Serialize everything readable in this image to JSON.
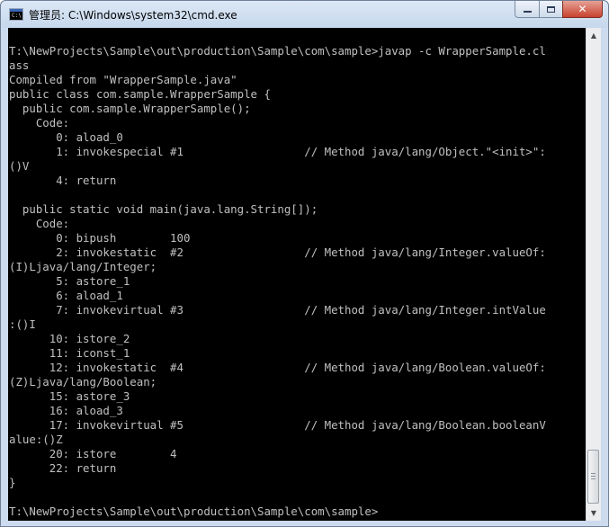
{
  "window": {
    "title": "管理员: C:\\Windows\\system32\\cmd.exe",
    "app_icon_text": "C:\\"
  },
  "caption_buttons": {
    "minimize_icon": "minimize-icon",
    "maximize_icon": "maximize-icon",
    "close_glyph": "✕"
  },
  "console": {
    "lines": [
      "T:\\NewProjects\\Sample\\out\\production\\Sample\\com\\sample>javap -c WrapperSample.cl",
      "ass",
      "Compiled from \"WrapperSample.java\"",
      "public class com.sample.WrapperSample {",
      "  public com.sample.WrapperSample();",
      "    Code:",
      "       0: aload_0",
      "       1: invokespecial #1                  // Method java/lang/Object.\"<init>\":",
      "()V",
      "       4: return",
      "",
      "  public static void main(java.lang.String[]);",
      "    Code:",
      "       0: bipush        100",
      "       2: invokestatic  #2                  // Method java/lang/Integer.valueOf:",
      "(I)Ljava/lang/Integer;",
      "       5: astore_1",
      "       6: aload_1",
      "       7: invokevirtual #3                  // Method java/lang/Integer.intValue",
      ":()I",
      "      10: istore_2",
      "      11: iconst_1",
      "      12: invokestatic  #4                  // Method java/lang/Boolean.valueOf:",
      "(Z)Ljava/lang/Boolean;",
      "      15: astore_3",
      "      16: aload_3",
      "      17: invokevirtual #5                  // Method java/lang/Boolean.booleanV",
      "alue:()Z",
      "      20: istore        4",
      "      22: return",
      "}",
      "",
      "T:\\NewProjects\\Sample\\out\\production\\Sample\\com\\sample>"
    ]
  },
  "scrollbar": {
    "up_arrow": "▲",
    "down_arrow": "▼",
    "position_fraction": 1.0
  }
}
